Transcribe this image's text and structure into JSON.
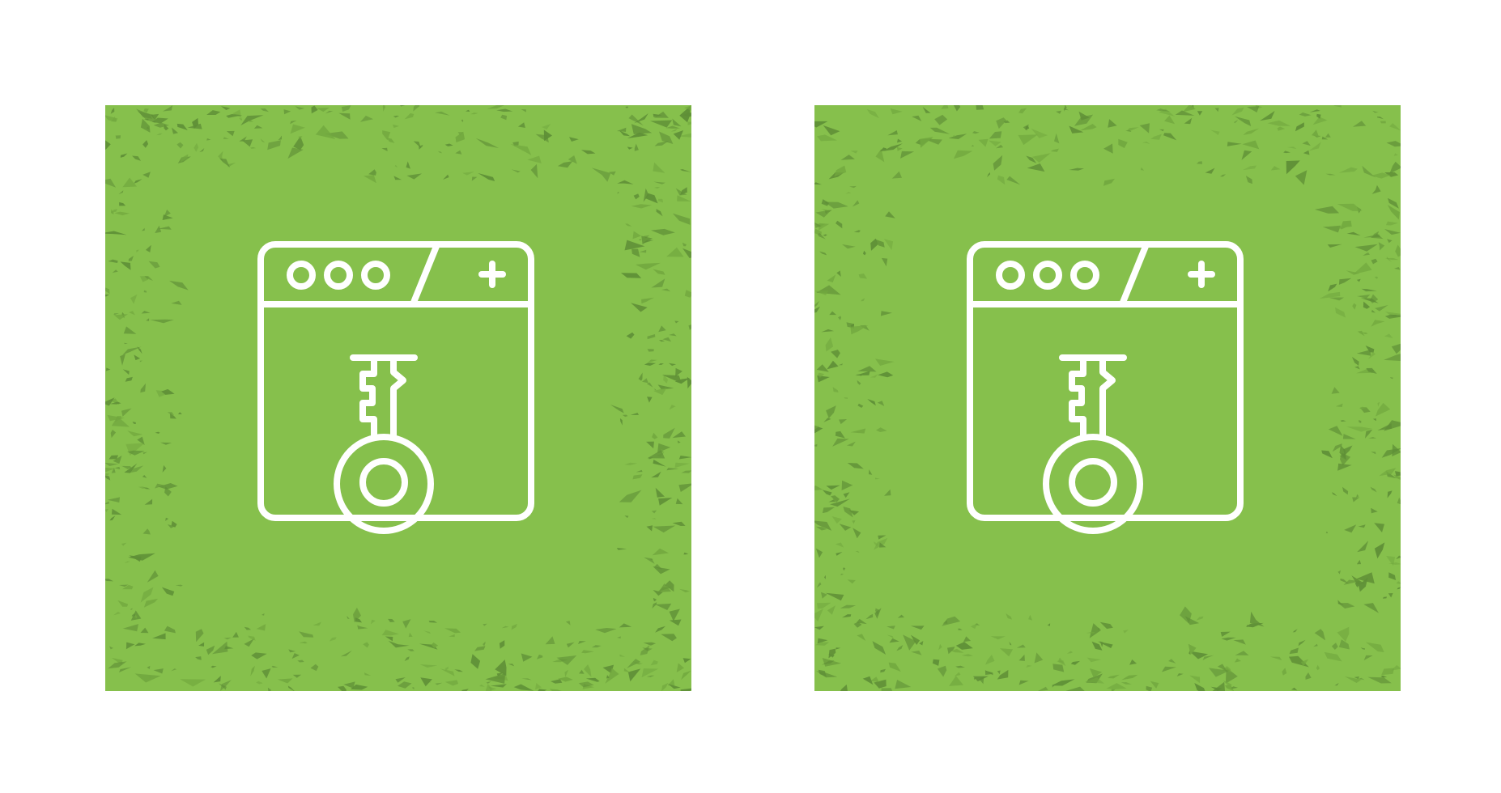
{
  "colors": {
    "page_background": "#ffffff",
    "tile_fill": "#86c04c",
    "texture_dark": "#5f8f37",
    "texture_mid": "#72a83f",
    "icon_stroke": "#ffffff"
  },
  "tiles": [
    {
      "id": "left",
      "icon": "browser-key-icon",
      "details": {
        "titlebar_dots": 3,
        "tab_symbol": "plus-icon",
        "emblem": "key-icon"
      }
    },
    {
      "id": "right",
      "icon": "browser-key-icon",
      "details": {
        "titlebar_dots": 3,
        "tab_symbol": "plus-icon",
        "emblem": "key-icon"
      }
    }
  ]
}
